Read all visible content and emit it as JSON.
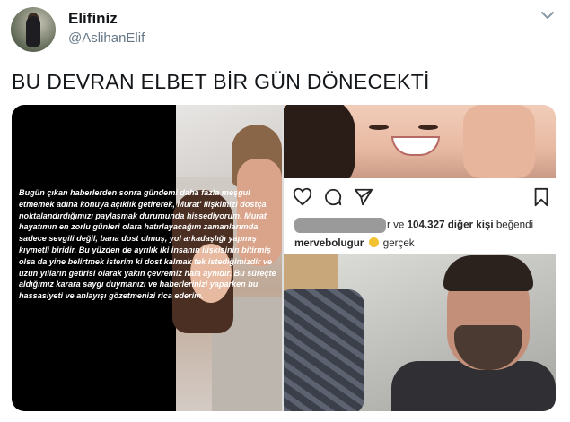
{
  "user": {
    "display_name": "Elifiniz",
    "handle": "@AslihanElif"
  },
  "tweet": {
    "text": "BU DEVRAN ELBET BİR GÜN DÖNECEKTİ"
  },
  "media": {
    "story_text": "Bugün çıkan haberlerden sonra gündemi daha fazla meşgul etmemek adına konuya açıklık getirerek, Murat' ilişkimizi dostça noktalandırdığımızı paylaşmak durumunda hissediyorum. Murat hayatımın en zorlu günleri olara hatırlayacağım zamanlarımda sadece sevgili değil, bana dost olmuş, yol arkadaşlığı yapmış kıymetli biridir. Bu yüzden de ayrılık iki insanın ilişkisinin bitirmiş olsa da yine belirtmek isterim ki dost kalmak tek istediğimizdir ve uzun yılların getirisi olarak yakın çevremiz hala aynıdır. Bu süreçte aldığımız karara saygı duymanızı ve haberlerinizi yaparken bu hassasiyeti ve anlayışı gözetmenizi rica ederim.",
    "likes_text_suffix": "r ve",
    "likes_count": "104.327 diğer kişi",
    "likes_tail": "beğendi",
    "commenter": "mervebolugur",
    "comment_text": "gerçek"
  },
  "icons": [
    "chevron-down-icon",
    "heart-icon",
    "comment-icon",
    "share-icon",
    "bookmark-icon",
    "heart-eyes-emoji-icon"
  ]
}
